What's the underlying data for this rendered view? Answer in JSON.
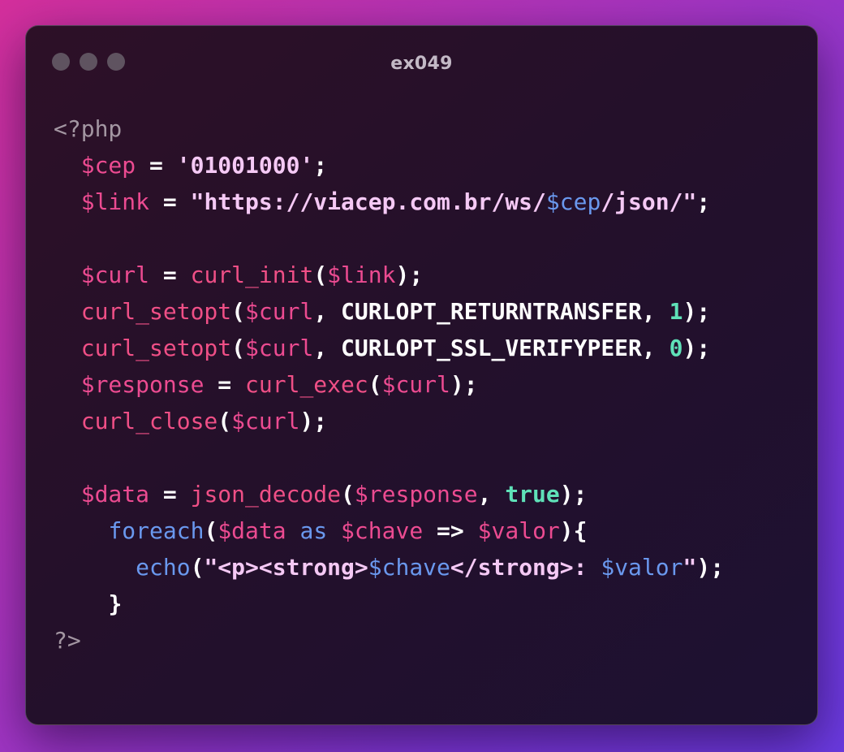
{
  "window": {
    "title": "ex049",
    "colors": {
      "close": "#5f5360",
      "minimize": "#5f5360",
      "zoom": "#5f5360"
    }
  },
  "code": {
    "language": "php",
    "lines": [
      [
        {
          "t": "<?php",
          "c": "meta"
        }
      ],
      [
        {
          "t": "  "
        },
        {
          "t": "$cep",
          "c": "var"
        },
        {
          "t": " = "
        },
        {
          "t": "'01001000'",
          "c": "str"
        },
        {
          "t": ";"
        }
      ],
      [
        {
          "t": "  "
        },
        {
          "t": "$link",
          "c": "var"
        },
        {
          "t": " = "
        },
        {
          "t": "\"https://viacep.com.br/ws/",
          "c": "str"
        },
        {
          "t": "$cep",
          "c": "strvar"
        },
        {
          "t": "/json/\"",
          "c": "str"
        },
        {
          "t": ";"
        }
      ],
      [],
      [
        {
          "t": "  "
        },
        {
          "t": "$curl",
          "c": "var"
        },
        {
          "t": " = "
        },
        {
          "t": "curl_init",
          "c": "func"
        },
        {
          "t": "("
        },
        {
          "t": "$link",
          "c": "var"
        },
        {
          "t": ");"
        }
      ],
      [
        {
          "t": "  "
        },
        {
          "t": "curl_setopt",
          "c": "func"
        },
        {
          "t": "("
        },
        {
          "t": "$curl",
          "c": "var"
        },
        {
          "t": ", "
        },
        {
          "t": "CURLOPT_RETURNTRANSFER",
          "c": "const"
        },
        {
          "t": ", "
        },
        {
          "t": "1",
          "c": "num"
        },
        {
          "t": ");"
        }
      ],
      [
        {
          "t": "  "
        },
        {
          "t": "curl_setopt",
          "c": "func"
        },
        {
          "t": "("
        },
        {
          "t": "$curl",
          "c": "var"
        },
        {
          "t": ", "
        },
        {
          "t": "CURLOPT_SSL_VERIFYPEER",
          "c": "const"
        },
        {
          "t": ", "
        },
        {
          "t": "0",
          "c": "num"
        },
        {
          "t": ");"
        }
      ],
      [
        {
          "t": "  "
        },
        {
          "t": "$response",
          "c": "var"
        },
        {
          "t": " = "
        },
        {
          "t": "curl_exec",
          "c": "func"
        },
        {
          "t": "("
        },
        {
          "t": "$curl",
          "c": "var"
        },
        {
          "t": ");"
        }
      ],
      [
        {
          "t": "  "
        },
        {
          "t": "curl_close",
          "c": "func"
        },
        {
          "t": "("
        },
        {
          "t": "$curl",
          "c": "var"
        },
        {
          "t": ");"
        }
      ],
      [],
      [
        {
          "t": "  "
        },
        {
          "t": "$data",
          "c": "var"
        },
        {
          "t": " = "
        },
        {
          "t": "json_decode",
          "c": "func"
        },
        {
          "t": "("
        },
        {
          "t": "$response",
          "c": "var"
        },
        {
          "t": ", "
        },
        {
          "t": "true",
          "c": "bool"
        },
        {
          "t": ");"
        }
      ],
      [
        {
          "t": "    "
        },
        {
          "t": "foreach",
          "c": "kw"
        },
        {
          "t": "("
        },
        {
          "t": "$data",
          "c": "var"
        },
        {
          "t": " "
        },
        {
          "t": "as",
          "c": "kw"
        },
        {
          "t": " "
        },
        {
          "t": "$chave",
          "c": "var"
        },
        {
          "t": " => "
        },
        {
          "t": "$valor",
          "c": "var"
        },
        {
          "t": "){"
        }
      ],
      [
        {
          "t": "      "
        },
        {
          "t": "echo",
          "c": "kw"
        },
        {
          "t": "("
        },
        {
          "t": "\"<p><strong>",
          "c": "str"
        },
        {
          "t": "$chave",
          "c": "strvar"
        },
        {
          "t": "</strong>: ",
          "c": "str"
        },
        {
          "t": "$valor",
          "c": "strvar"
        },
        {
          "t": "\"",
          "c": "str"
        },
        {
          "t": ");"
        }
      ],
      [
        {
          "t": "    "
        },
        {
          "t": "}"
        }
      ],
      [
        {
          "t": "?>",
          "c": "meta"
        }
      ]
    ]
  }
}
